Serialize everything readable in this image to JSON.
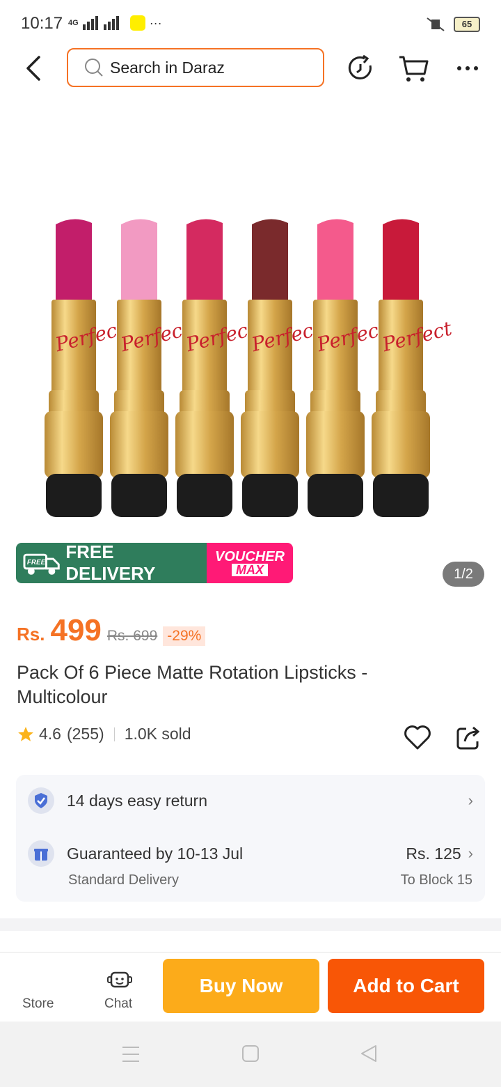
{
  "status_bar": {
    "time": "10:17",
    "network": "4G",
    "battery": "65"
  },
  "header": {
    "search_placeholder": "Search in Daraz"
  },
  "badges": {
    "free_tag": "FREE",
    "free_delivery": "FREE DELIVERY",
    "voucher": "VOUCHER",
    "voucher_max": "MAX"
  },
  "gallery": {
    "counter": "1/2"
  },
  "price": {
    "currency": "Rs.",
    "current": "499",
    "original": "Rs. 699",
    "discount": "-29%"
  },
  "product": {
    "title": "Pack Of 6 Piece Matte Rotation Lipsticks - Multicolour",
    "lipstick_brand": "Perfect"
  },
  "rating": {
    "score": "4.6",
    "count": "(255)",
    "sold": "1.0K sold"
  },
  "services": {
    "return_text": "14 days easy return",
    "delivery_text": "Guaranteed by 10-13 Jul",
    "delivery_sub": "Standard Delivery",
    "delivery_fee": "Rs. 125",
    "delivery_location": "To Block 15"
  },
  "bottom_bar": {
    "store": "Store",
    "chat": "Chat",
    "buy_now": "Buy Now",
    "add_to_cart": "Add to Cart"
  },
  "colors": {
    "accent": "#f57224",
    "buy_now": "#fcab1a",
    "add_to_cart": "#f85606",
    "free_delivery_bg": "#2f7d5c",
    "voucher_bg": "#ff1a76",
    "lipstick_shades": [
      "#c21e6a",
      "#f29ac2",
      "#d42a60",
      "#7a2a2c",
      "#f45a8c",
      "#c81a3a"
    ]
  },
  "icons": [
    "back-arrow-icon",
    "search-icon",
    "history-icon",
    "cart-icon",
    "more-icon",
    "truck-icon",
    "star-icon",
    "heart-icon",
    "share-icon",
    "shield-check-icon",
    "gift-icon",
    "chevron-right-icon",
    "chat-icon"
  ]
}
